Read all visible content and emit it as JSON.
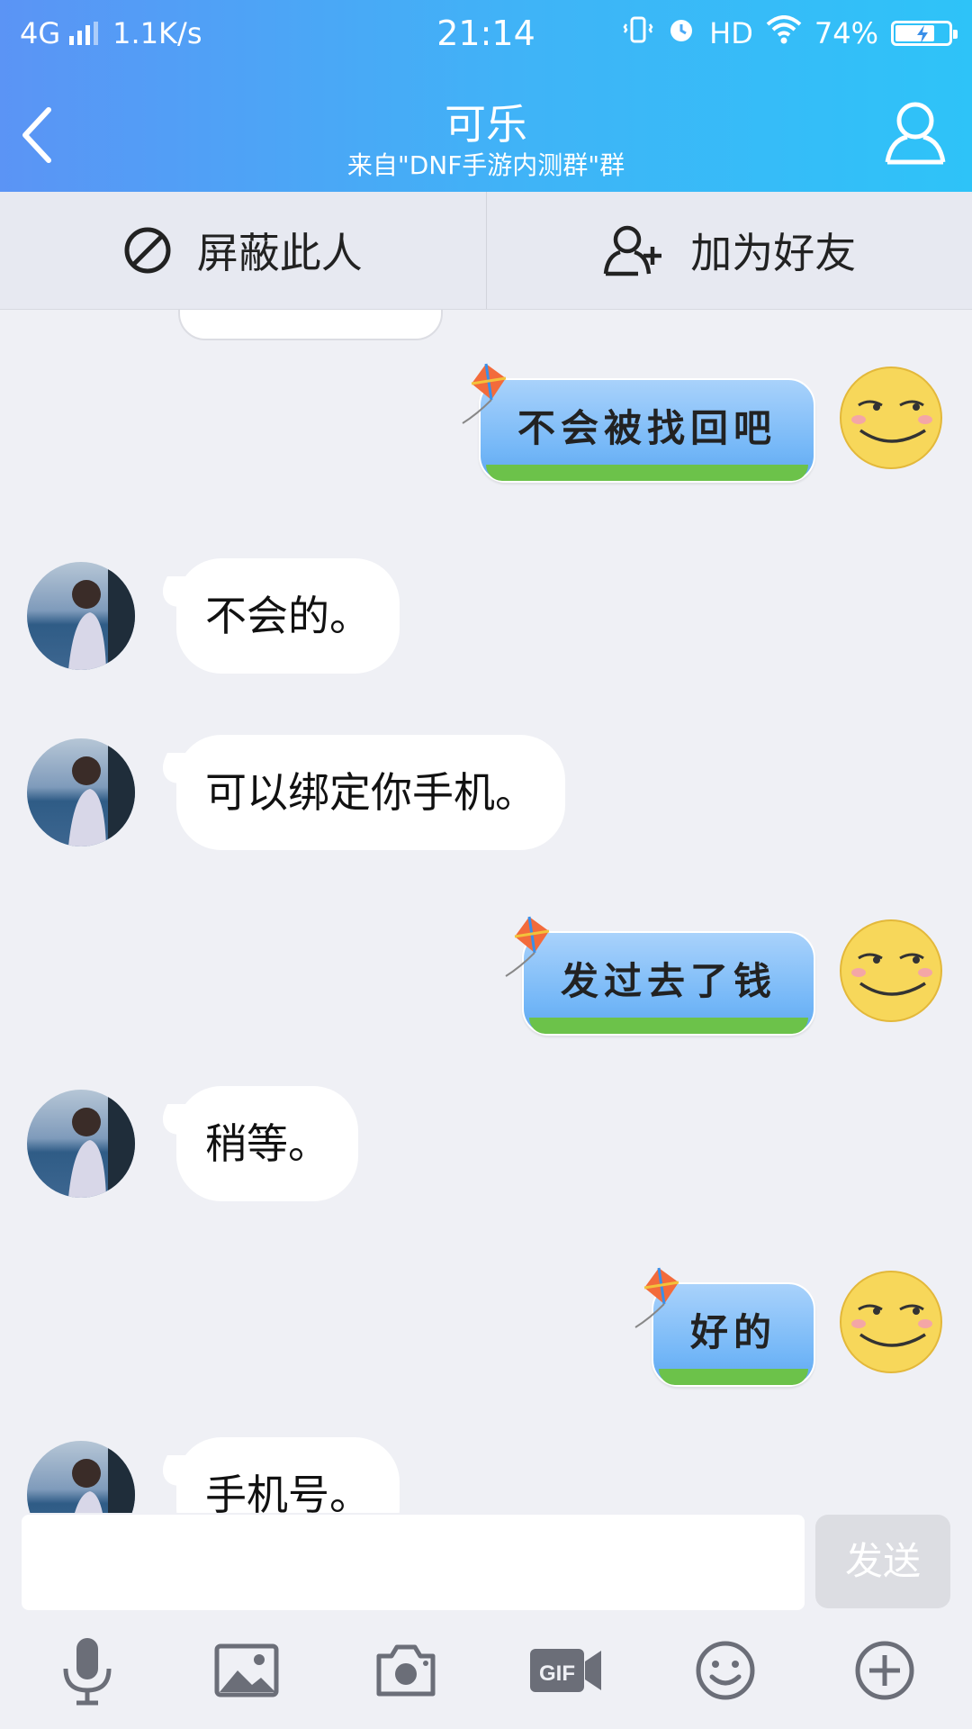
{
  "status_bar": {
    "network": "4G",
    "speed": "1.1K/s",
    "time": "21:14",
    "hd": "HD",
    "battery": "74%",
    "battery_level": 0.74
  },
  "header": {
    "title": "可乐",
    "subtitle": "来自\"DNF手游内测群\"群"
  },
  "actions": {
    "block_label": "屏蔽此人",
    "add_friend_label": "加为好友"
  },
  "messages": [
    {
      "side": "out",
      "text": "不会被找回吧"
    },
    {
      "side": "in",
      "text": "不会的。"
    },
    {
      "side": "in",
      "text": "可以绑定你手机。"
    },
    {
      "side": "out",
      "text": "发过去了钱"
    },
    {
      "side": "in",
      "text": "稍等。"
    },
    {
      "side": "out",
      "text": "好的"
    },
    {
      "side": "in",
      "text": "手机号。"
    }
  ],
  "input": {
    "value": "",
    "send_label": "发送"
  },
  "toolbar": {
    "icons": [
      "microphone-icon",
      "image-icon",
      "camera-icon",
      "gif-icon",
      "emoji-icon",
      "plus-icon"
    ]
  },
  "colors": {
    "header_start": "#5b94f5",
    "header_end": "#2ec3f8",
    "chat_bg": "#eff0f5",
    "bubble_out": "#72b6f7"
  }
}
